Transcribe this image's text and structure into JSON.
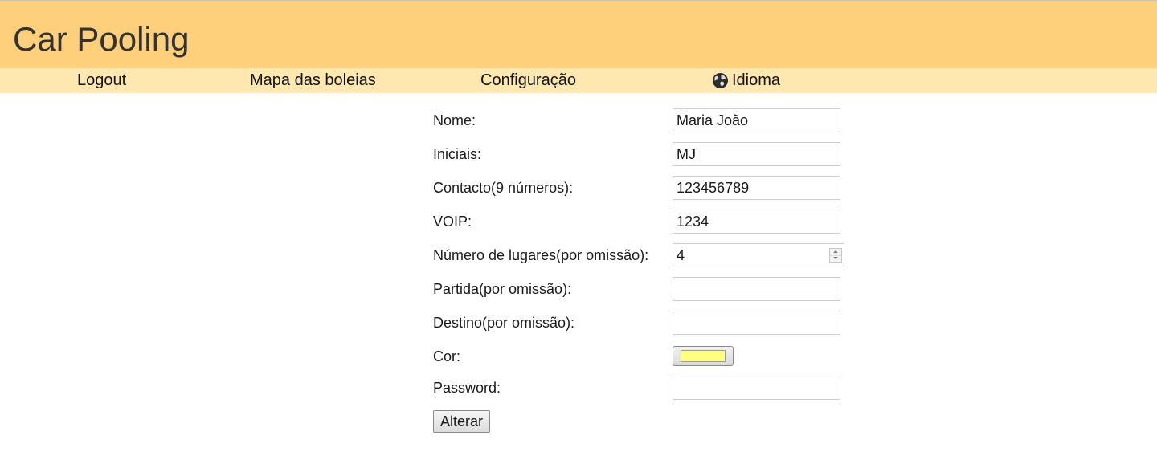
{
  "header": {
    "title": "Car Pooling"
  },
  "nav": {
    "logout": "Logout",
    "map": "Mapa das boleias",
    "config": "Configuração",
    "language": "Idioma",
    "language_icon": "globe-icon"
  },
  "form": {
    "nome": {
      "label": "Nome:",
      "value": "Maria João"
    },
    "iniciais": {
      "label": "Iniciais:",
      "value": "MJ"
    },
    "contacto": {
      "label": "Contacto(9 números):",
      "value": "123456789"
    },
    "voip": {
      "label": "VOIP:",
      "value": "1234"
    },
    "lugares": {
      "label": "Número de lugares(por omissão):",
      "value": "4"
    },
    "partida": {
      "label": "Partida(por omissão):",
      "value": ""
    },
    "destino": {
      "label": "Destino(por omissão):",
      "value": ""
    },
    "cor": {
      "label": "Cor:",
      "value": "#ffff80"
    },
    "password": {
      "label": "Password:",
      "value": ""
    },
    "submit_label": "Alterar"
  },
  "colors": {
    "header_bg": "#ffd07c",
    "nav_bg": "#ffe8b0"
  }
}
